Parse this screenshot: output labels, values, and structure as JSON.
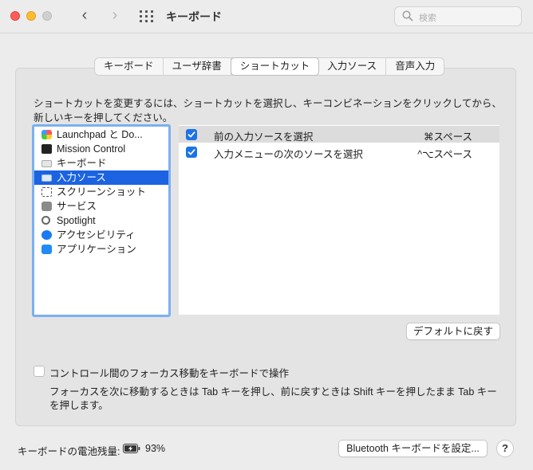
{
  "window": {
    "title": "キーボード",
    "search_placeholder": "検索"
  },
  "tabs": [
    {
      "label": "キーボード",
      "active": false
    },
    {
      "label": "ユーザ辞書",
      "active": false
    },
    {
      "label": "ショートカット",
      "active": true
    },
    {
      "label": "入力ソース",
      "active": false
    },
    {
      "label": "音声入力",
      "active": false
    }
  ],
  "instruction": "ショートカットを変更するには、ショートカットを選択し、キーコンビネーションをクリックしてから、新しいキーを押してください。",
  "categories": [
    {
      "label": "Launchpad と Do...",
      "icon": "launchpad-icon",
      "selected": false
    },
    {
      "label": "Mission Control",
      "icon": "mission-control-icon",
      "selected": false
    },
    {
      "label": "キーボード",
      "icon": "keyboard-icon",
      "selected": false
    },
    {
      "label": "入力ソース",
      "icon": "input-source-icon",
      "selected": true
    },
    {
      "label": "スクリーンショット",
      "icon": "screenshot-icon",
      "selected": false
    },
    {
      "label": "サービス",
      "icon": "services-gear-icon",
      "selected": false
    },
    {
      "label": "Spotlight",
      "icon": "spotlight-icon",
      "selected": false
    },
    {
      "label": "アクセシビリティ",
      "icon": "accessibility-icon",
      "selected": false
    },
    {
      "label": "アプリケーション",
      "icon": "app-store-icon",
      "selected": false
    }
  ],
  "shortcuts": [
    {
      "name": "前の入力ソースを選択",
      "keys": "⌘スペース",
      "checked": true
    },
    {
      "name": "入力メニューの次のソースを選択",
      "keys": "^⌥スペース",
      "checked": true
    }
  ],
  "restore_defaults_label": "デフォルトに戻す",
  "keyboard_navigation": {
    "label": "コントロール間のフォーカス移動をキーボードで操作",
    "checked": false,
    "description": "フォーカスを次に移動するときは Tab キーを押し、前に戻すときは Shift キーを押したまま Tab キーを押します。"
  },
  "footer": {
    "battery_label": "キーボードの電池残量:",
    "battery_percent": "93%",
    "bluetooth_button": "Bluetooth キーボードを設定...",
    "help_label": "?"
  },
  "colors": {
    "accent": "#1b63e0",
    "checkbox": "#1b73e8",
    "list_focus_ring": "#7ab0f2"
  }
}
